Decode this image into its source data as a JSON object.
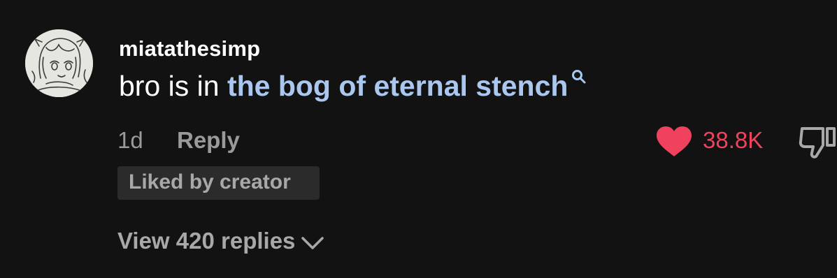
{
  "comment": {
    "username": "miatathesimp",
    "text_prefix": "bro is in ",
    "link_text": "the bog of eternal stench",
    "timestamp": "1d",
    "reply_label": "Reply",
    "like_count": "38.8K",
    "liked_badge": "Liked by creator",
    "view_replies_label": "View 420 replies"
  },
  "icons": {
    "avatar": "anime-avatar",
    "search": "search-icon",
    "like": "heart-icon",
    "dislike": "thumbs-down-icon",
    "expand": "chevron-down-icon"
  },
  "colors": {
    "background": "#121212",
    "text": "#ffffff",
    "link": "#a9c7ef",
    "muted": "#9a9a9a",
    "like": "#f0425f",
    "badge_bg": "#2b2b2b"
  }
}
